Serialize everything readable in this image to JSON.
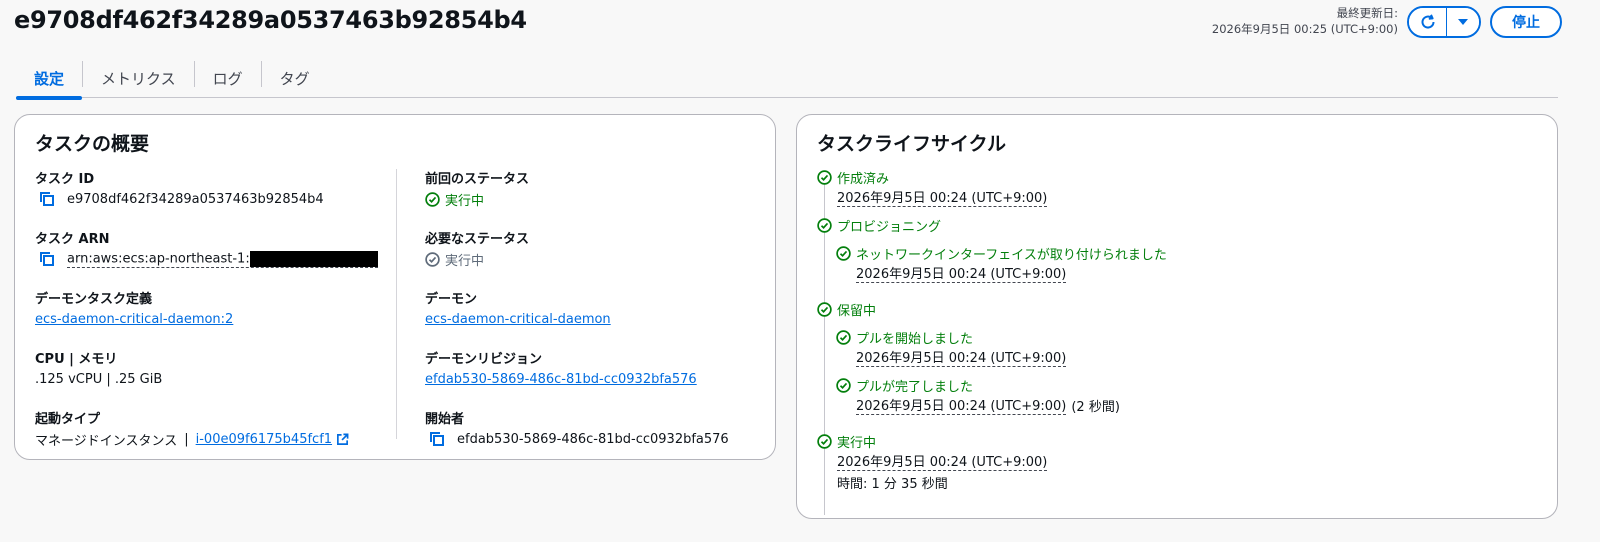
{
  "header": {
    "title": "e9708df462f34289a0537463b92854b4",
    "last_updated_label": "最終更新日:",
    "last_updated_value": "2026年9月5日 00:25 (UTC+9:00)",
    "stop_label": "停止"
  },
  "tabs": [
    {
      "label": "設定"
    },
    {
      "label": "メトリクス"
    },
    {
      "label": "ログ"
    },
    {
      "label": "タグ"
    }
  ],
  "summary": {
    "title": "タスクの概要",
    "left": {
      "task_id_label": "タスク ID",
      "task_id_value": "e9708df462f34289a0537463b92854b4",
      "task_arn_label": "タスク ARN",
      "task_arn_value": "arn:aws:ecs:ap-northeast-1:",
      "daemon_def_label": "デーモンタスク定義",
      "daemon_def_value": "ecs-daemon-critical-daemon:2",
      "cpu_label": "CPU | メモリ",
      "cpu_value": ".125 vCPU | .25 GiB",
      "launch_label": "起動タイプ",
      "launch_value": "マネージドインスタンス",
      "launch_sep": "|",
      "instance_link": "i-00e09f6175b45fcf1"
    },
    "right": {
      "prev_status_label": "前回のステータス",
      "prev_status_value": "実行中",
      "desired_status_label": "必要なステータス",
      "desired_status_value": "実行中",
      "daemon_label": "デーモン",
      "daemon_value": "ecs-daemon-critical-daemon",
      "revision_label": "デーモンリビジョン",
      "revision_value": "efdab530-5869-486c-81bd-cc0932bfa576",
      "started_by_label": "開始者",
      "started_by_value": "efdab530-5869-486c-81bd-cc0932bfa576"
    }
  },
  "lifecycle": {
    "title": "タスクライフサイクル",
    "created_label": "作成済み",
    "created_time": "2026年9月5日 00:24 (UTC+9:00)",
    "provisioning_label": "プロビジョニング",
    "eni_label": "ネットワークインターフェイスが取り付けられました",
    "eni_time": "2026年9月5日 00:24 (UTC+9:00)",
    "pending_label": "保留中",
    "pull_start_label": "プルを開始しました",
    "pull_start_time": "2026年9月5日 00:24 (UTC+9:00)",
    "pull_done_label": "プルが完了しました",
    "pull_done_time": "2026年9月5日 00:24 (UTC+9:00)",
    "pull_done_duration": "(2 秒間)",
    "running_label": "実行中",
    "running_time": "2026年9月5日 00:24 (UTC+9:00)",
    "running_duration": "時間: 1 分 35 秒間"
  },
  "colors": {
    "accent": "#006ce0",
    "success": "#037f0c",
    "muted": "#5f6b7a"
  },
  "icons": [
    "refresh-icon",
    "caret-down-icon",
    "copy-icon",
    "status-check-icon",
    "external-link-icon"
  ]
}
